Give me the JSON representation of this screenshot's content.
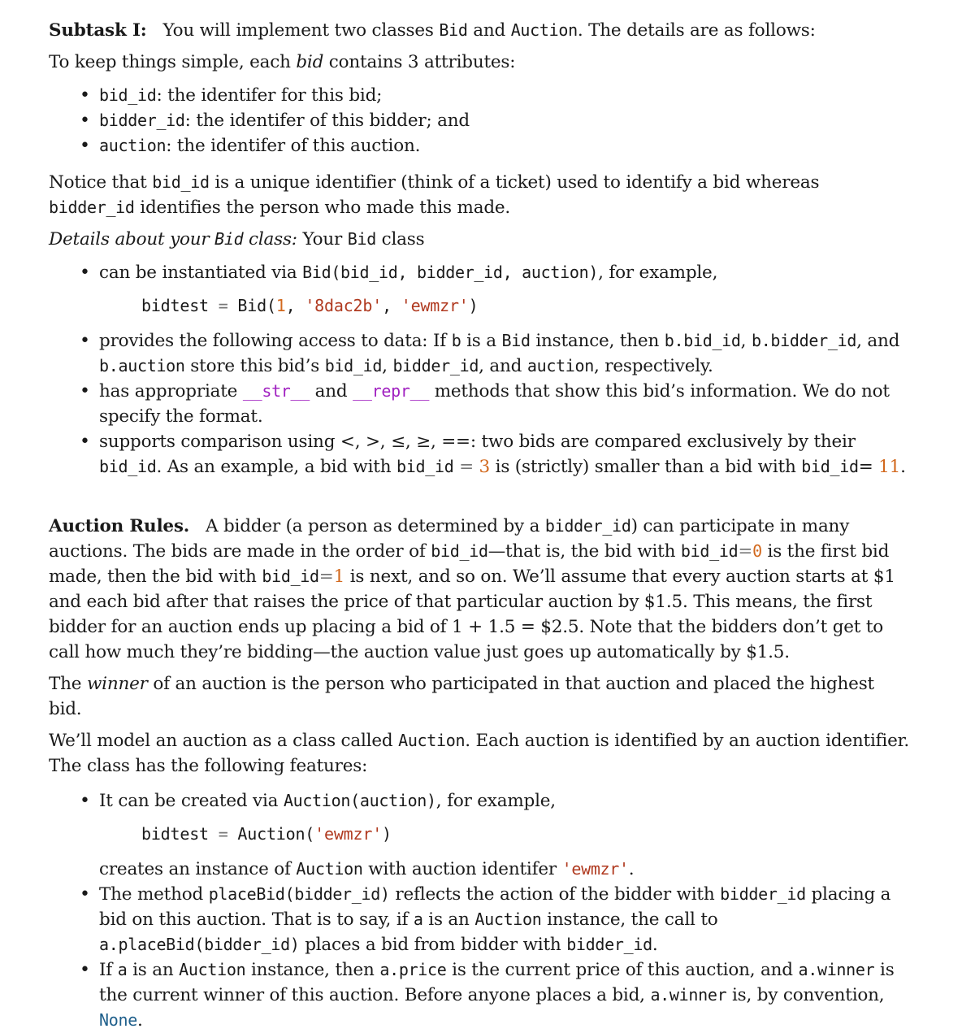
{
  "subtask": {
    "heading": "Subtask I:",
    "intro_a": "You will implement two classes ",
    "class_bid": "Bid",
    "and": " and ",
    "class_auction": "Auction",
    "intro_b": ". The details are as follows:"
  },
  "attributes_intro": {
    "a": "To keep things simple, each ",
    "em": "bid",
    "b": " contains 3 attributes:"
  },
  "attributes": [
    {
      "code": "bid_id",
      "text": ": the identifer for this bid;"
    },
    {
      "code": "bidder_id",
      "text": ": the identifer of this bidder; and"
    },
    {
      "code": "auction",
      "text": ": the identifer of this auction."
    }
  ],
  "notice": {
    "a": "Notice that ",
    "code1": "bid_id",
    "b": " is a unique identifier (think of a ticket) used to identify a bid whereas ",
    "code2": "bidder_id",
    "c": " identifies the person who made this made."
  },
  "details": {
    "em_a": "Details about your ",
    "em_code": "Bid",
    "em_b": " class:",
    "a": " Your ",
    "code": "Bid",
    "b": " class"
  },
  "bid_features": {
    "instantiate": {
      "a": "can be instantiated via ",
      "code": "Bid(bid_id, bidder_id, auction)",
      "b": ", for example,"
    },
    "example": {
      "var": "bidtest",
      "eq": "=",
      "call": "Bid(",
      "num": "1",
      "sep1": ", ",
      "s1": "'8dac2b'",
      "sep2": ", ",
      "s2": "'ewmzr'",
      "close": ")"
    },
    "access": {
      "a": "provides the following access to data: If ",
      "c1": "b",
      "b": " is a ",
      "c2": "Bid",
      "c": " instance, then ",
      "c3": "b.bid_id",
      "d": ", ",
      "c4": "b.bidder_id",
      "e": ", and ",
      "c5": "b.auction",
      "f": " store this bid’s ",
      "c6": "bid_id",
      "g": ", ",
      "c7": "bidder_id",
      "h": ", and ",
      "c8": "auction",
      "i": ", respectively."
    },
    "methods": {
      "a": "has appropriate ",
      "str": "__str__",
      "b": " and ",
      "repr": "__repr__",
      "c": " methods that show this bid’s information. We do not specify the format."
    },
    "compare": {
      "a": "supports comparison using ",
      "ops": "<, >, ≤, ≥, ==",
      "b": ": two bids are compared exclusively by their ",
      "c1": "bid_id",
      "c": ". As an example, a bid with ",
      "c2": "bid_id",
      "eq": " = ",
      "n1": "3",
      "d": " is (strictly) smaller than a bid with ",
      "c3": "bid_id",
      "e": "= ",
      "n2": "11",
      "f": "."
    }
  },
  "rules": {
    "heading": "Auction Rules.",
    "a": "A bidder (a person as determined by a ",
    "c1": "bidder_id",
    "b": ") can participate in many auctions. The bids are made in the order of ",
    "c2": "bid_id",
    "c": "—that is, the bid with ",
    "c3": "bid_id",
    "eq1": "=",
    "n1": "0",
    "d": " is the first bid made, then the bid with ",
    "c4": "bid_id",
    "eq2": "=",
    "n2": "1",
    "e": " is next, and so on. We’ll assume that every auction starts at $1 and each bid after that raises the price of that particular auction by $1.5. This means, the first bidder for an auction ends up placing a bid of 1 + 1.5 = $2.5. Note that the bidders don’t get to call how much they’re bidding—the auction value just goes up automatically by $1.5."
  },
  "winner": {
    "a": "The ",
    "em": "winner",
    "b": " of an auction is the person who participated in that auction and placed the highest bid."
  },
  "model": {
    "a": "We’ll model an auction as a class called ",
    "code": "Auction",
    "b": ". Each auction is identified by an auction identifier. The class has the following features:"
  },
  "auction_features": {
    "create": {
      "a": "It can be created via ",
      "code": "Auction(auction)",
      "b": ", for example,"
    },
    "example": {
      "var": "bidtest",
      "eq": "=",
      "call": "Auction(",
      "s1": "'ewmzr'",
      "close": ")"
    },
    "creates": {
      "a": "creates an instance of ",
      "code": "Auction",
      "b": " with auction identifer ",
      "s": "'ewmzr'",
      "c": "."
    },
    "place": {
      "a": "The method ",
      "c1": "placeBid(bidder_id)",
      "b": " reflects the action of the bidder with ",
      "c2": "bidder_id",
      "c": " placing a bid on this auction. That is to say, if ",
      "c3": "a",
      "d": " is an ",
      "c4": "Auction",
      "e": " instance, the call to ",
      "c5": "a.placeBid(bidder_id)",
      "f": " places a bid from bidder with ",
      "c6": "bidder_id",
      "g": "."
    },
    "price": {
      "a": "If ",
      "c1": "a",
      "b": " is an ",
      "c2": "Auction",
      "c": " instance, then ",
      "c3": "a.price",
      "d": " is the current price of this auction, and ",
      "c4": "a.winner",
      "e": " is the current winner of this auction. Before anyone places a bid, ",
      "c5": "a.winner",
      "f": " is, by convention, ",
      "kw": "None",
      "g": "."
    }
  }
}
